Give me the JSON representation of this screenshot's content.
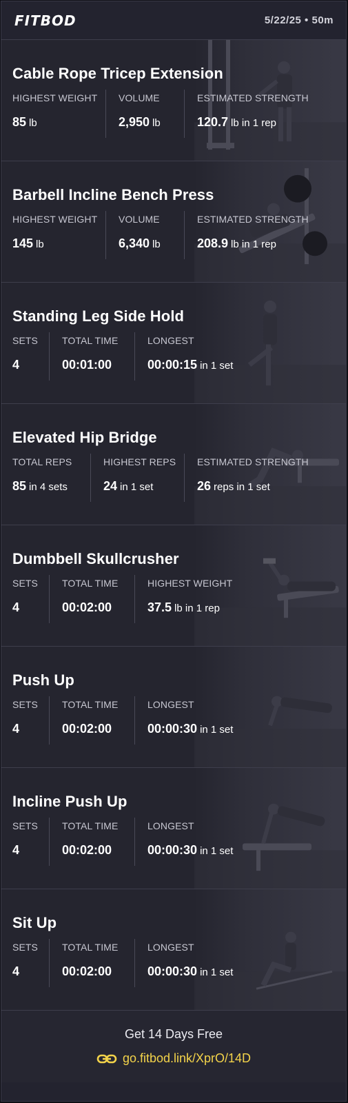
{
  "header": {
    "logo": "FITBOD",
    "meta": "5/22/25 • 50m"
  },
  "exercises": [
    {
      "name": "Cable Rope Tricep Extension",
      "stats": [
        {
          "label": "HIGHEST WEIGHT",
          "value": "85",
          "unit": "lb"
        },
        {
          "label": "VOLUME",
          "value": "2,950",
          "unit": "lb"
        },
        {
          "label": "ESTIMATED STRENGTH",
          "value": "120.7",
          "unit": "lb in 1 rep"
        }
      ]
    },
    {
      "name": "Barbell Incline Bench Press",
      "stats": [
        {
          "label": "HIGHEST WEIGHT",
          "value": "145",
          "unit": "lb"
        },
        {
          "label": "VOLUME",
          "value": "6,340",
          "unit": "lb"
        },
        {
          "label": "ESTIMATED STRENGTH",
          "value": "208.9",
          "unit": "lb in 1 rep"
        }
      ]
    },
    {
      "name": "Standing Leg Side Hold",
      "stats": [
        {
          "label": "SETS",
          "value": "4",
          "unit": ""
        },
        {
          "label": "TOTAL TIME",
          "value": "00:01:00",
          "unit": ""
        },
        {
          "label": "LONGEST",
          "value": "00:00:15",
          "unit": "in 1 set"
        }
      ]
    },
    {
      "name": "Elevated Hip Bridge",
      "stats": [
        {
          "label": "TOTAL REPS",
          "value": "85",
          "unit": "in 4 sets"
        },
        {
          "label": "HIGHEST REPS",
          "value": "24",
          "unit": "in 1 set"
        },
        {
          "label": "ESTIMATED STRENGTH",
          "value": "26",
          "unit": "reps in 1 set"
        }
      ]
    },
    {
      "name": "Dumbbell Skullcrusher",
      "stats": [
        {
          "label": "SETS",
          "value": "4",
          "unit": ""
        },
        {
          "label": "TOTAL TIME",
          "value": "00:02:00",
          "unit": ""
        },
        {
          "label": "HIGHEST WEIGHT",
          "value": "37.5",
          "unit": "lb in 1 rep"
        }
      ]
    },
    {
      "name": "Push Up",
      "stats": [
        {
          "label": "SETS",
          "value": "4",
          "unit": ""
        },
        {
          "label": "TOTAL TIME",
          "value": "00:02:00",
          "unit": ""
        },
        {
          "label": "LONGEST",
          "value": "00:00:30",
          "unit": "in 1 set"
        }
      ]
    },
    {
      "name": "Incline Push Up",
      "stats": [
        {
          "label": "SETS",
          "value": "4",
          "unit": ""
        },
        {
          "label": "TOTAL TIME",
          "value": "00:02:00",
          "unit": ""
        },
        {
          "label": "LONGEST",
          "value": "00:00:30",
          "unit": "in 1 set"
        }
      ]
    },
    {
      "name": "Sit Up",
      "stats": [
        {
          "label": "SETS",
          "value": "4",
          "unit": ""
        },
        {
          "label": "TOTAL TIME",
          "value": "00:02:00",
          "unit": ""
        },
        {
          "label": "LONGEST",
          "value": "00:00:30",
          "unit": "in 1 set"
        }
      ]
    }
  ],
  "footer": {
    "cta": "Get 14 Days Free",
    "link": "go.fitbod.link/XprO/14D"
  },
  "colors": {
    "background": "#23232f",
    "accent": "#f3d34a",
    "divider": "#3e3e4c"
  }
}
